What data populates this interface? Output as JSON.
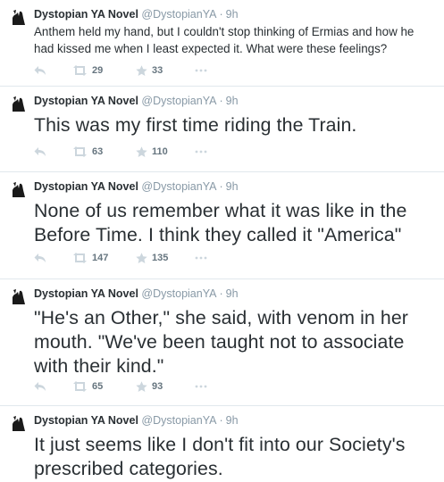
{
  "author": {
    "name": "Dystopian YA Novel",
    "handle": "@DystopianYA",
    "separator": "·",
    "avatar_icon": "silhouette-icon"
  },
  "icons": {
    "reply": "reply-icon",
    "retweet": "retweet-icon",
    "favorite": "star-icon",
    "more": "more-dots-icon"
  },
  "colors": {
    "text": "#292f33",
    "muted": "#8899a6",
    "action_icon": "#ccd6dd",
    "divider": "#e1e8ed"
  },
  "tweets": [
    {
      "time": "9h",
      "text": "Anthem held my hand, but I couldn't stop thinking of Ermias and how he had kissed me when I least expected it. What were these feelings?",
      "retweets": "29",
      "favorites": "33"
    },
    {
      "time": "9h",
      "text": "This was my first time riding the Train.",
      "retweets": "63",
      "favorites": "110"
    },
    {
      "time": "9h",
      "text": "None of us remember what it was like in the Before Time. I think they called it \"America\"",
      "retweets": "147",
      "favorites": "135"
    },
    {
      "time": "9h",
      "text": "\"He's an Other,\" she said, with venom in her mouth. \"We've been taught not to associate with their kind.\"",
      "retweets": "65",
      "favorites": "93"
    },
    {
      "time": "9h",
      "text": "It just seems like I don't fit into our Society's prescribed categories."
    }
  ]
}
